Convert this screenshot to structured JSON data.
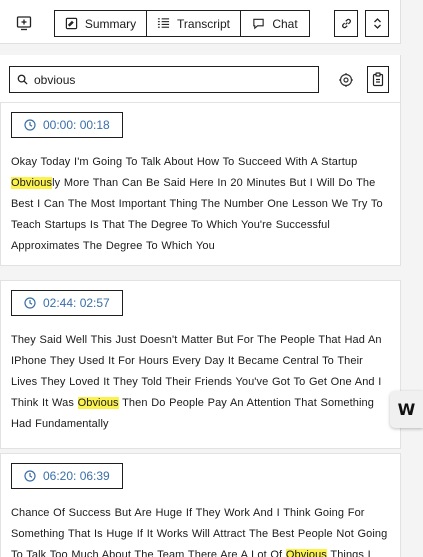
{
  "toolbar": {
    "tabs": [
      {
        "label": "Summary",
        "icon": "summary-icon"
      },
      {
        "label": "Transcript",
        "icon": "transcript-icon"
      },
      {
        "label": "Chat",
        "icon": "chat-icon"
      }
    ],
    "left_icon": "add-panel-icon",
    "right_icons": [
      "link-icon",
      "expand-collapse-icon"
    ]
  },
  "search": {
    "value": "obvious",
    "icons": [
      "search-icon",
      "ai-icon",
      "copy-icon"
    ]
  },
  "cards": [
    {
      "timestamp": "00:00: 00:18",
      "text_before": "Okay Today I'm Going To Talk About How To Succeed With A Startup ",
      "match": "Obvious",
      "text_after": "ly More Than Can Be Said Here In 20 Minutes But I Will Do The Best I Can The Most Important Thing The Number One Lesson We Try To Teach Startups Is That The Degree To Which You're Successful Approximates The Degree To Which You"
    },
    {
      "timestamp": "02:44: 02:57",
      "text_before": "They Said Well This Just Doesn't Matter But For The People That Had An IPhone They Used It For Hours Every Day It Became Central To Their Lives They Loved It They Told Their Friends You've Got To Get One And I Think It Was ",
      "match": "Obvious",
      "text_after": " Then Do People Pay An Attention That Something Had Fundamentally"
    },
    {
      "timestamp": "06:20: 06:39",
      "text_before": "Chance Of Success But Are Huge If They Work And I Think Going For Something That Is Huge If It Works Will Attract The Best People Not Going To Talk Too Much About The Team There Are A Lot Of ",
      "match": "Obvious",
      "text_after": " Things I"
    }
  ],
  "floating_widget": {
    "label": "W"
  },
  "colors": {
    "highlight": "#fbf24e",
    "timestamp": "#3a6ea8",
    "border": "#1e1e1e"
  }
}
